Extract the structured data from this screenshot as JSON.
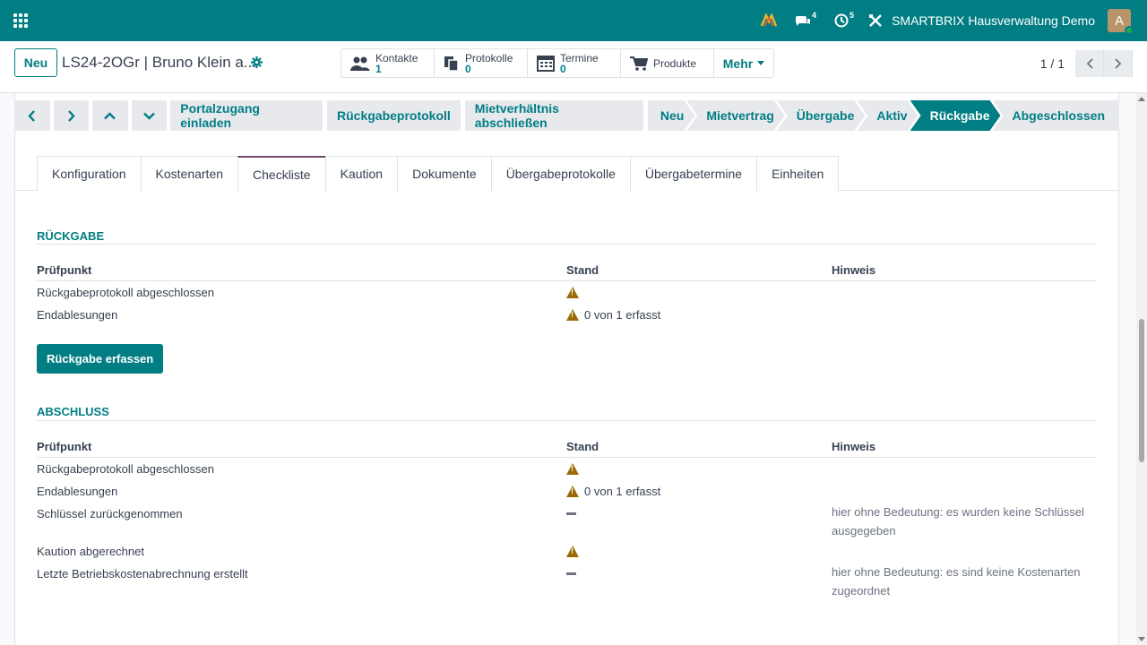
{
  "navbar": {
    "chat_badge": "4",
    "activity_badge": "5",
    "company": "SMARTBRIX Hausverwaltung Demo",
    "avatar_letter": "A"
  },
  "control": {
    "new_label": "Neu",
    "record_title": "LS24-2OGr | Bruno Klein a...",
    "smart_buttons": [
      {
        "label": "Kontakte",
        "count": "1"
      },
      {
        "label": "Protokolle",
        "count": "0"
      },
      {
        "label": "Termine",
        "count": "0"
      },
      {
        "label": "Produkte"
      }
    ],
    "more_label": "Mehr",
    "pager": "1 / 1"
  },
  "statusbar": {
    "actions": [
      "Portalzugang einladen",
      "Rückgabeprotokoll",
      "Mietverhältnis abschließen"
    ],
    "stages": [
      "Neu",
      "Mietvertrag",
      "Übergabe",
      "Aktiv",
      "Rückgabe",
      "Abgeschlossen"
    ],
    "active_stage": "Rückgabe"
  },
  "tabs": [
    "Konfiguration",
    "Kostenarten",
    "Checkliste",
    "Kaution",
    "Dokumente",
    "Übergabeprotokolle",
    "Übergabetermine",
    "Einheiten"
  ],
  "active_tab": "Checkliste",
  "columns": {
    "pruefpunkt": "Prüfpunkt",
    "stand": "Stand",
    "hinweis": "Hinweis"
  },
  "rueckgabe": {
    "title": "RÜCKGABE",
    "rows": [
      {
        "pruefpunkt": "Rückgabeprotokoll abgeschlossen",
        "status": "warning",
        "stand": "",
        "hinweis": ""
      },
      {
        "pruefpunkt": "Endablesungen",
        "status": "warning",
        "stand": "0 von 1 erfasst",
        "hinweis": ""
      }
    ],
    "button_label": "Rückgabe erfassen"
  },
  "abschluss": {
    "title": "ABSCHLUSS",
    "rows": [
      {
        "pruefpunkt": "Rückgabeprotokoll abgeschlossen",
        "status": "warning",
        "stand": "",
        "hinweis": ""
      },
      {
        "pruefpunkt": "Endablesungen",
        "status": "warning",
        "stand": "0 von 1 erfasst",
        "hinweis": ""
      },
      {
        "pruefpunkt": "Schlüssel zurückgenommen",
        "status": "neutral",
        "stand": "",
        "hinweis": "hier ohne Bedeutung: es wurden keine Schlüssel ausgegeben"
      },
      {
        "pruefpunkt": "Kaution abgerechnet",
        "status": "warning",
        "stand": "",
        "hinweis": ""
      },
      {
        "pruefpunkt": "Letzte Betriebskostenabrechnung erstellt",
        "status": "neutral",
        "stand": "",
        "hinweis": "hier ohne Bedeutung: es sind keine Kostenarten zugeordnet"
      }
    ]
  },
  "colors": {
    "primary": "#017e84",
    "warning": "#9a6b04",
    "tab_accent": "#714b67"
  }
}
